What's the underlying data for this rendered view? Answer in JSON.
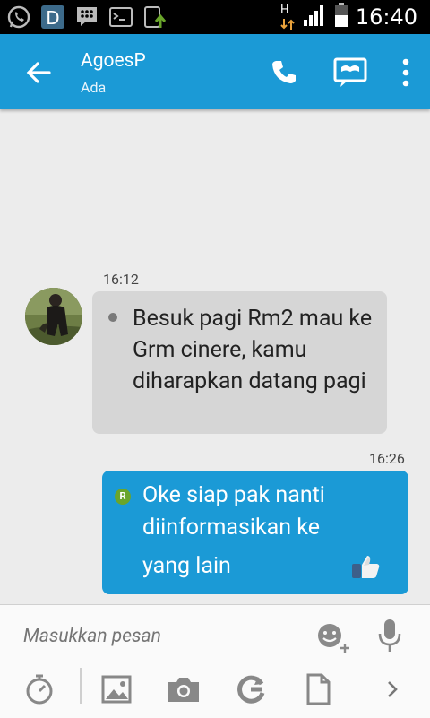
{
  "status_bar": {
    "time": "16:40",
    "network": "H"
  },
  "header": {
    "contact_name": "AgoesP",
    "status": "Ada"
  },
  "messages": [
    {
      "time": "16:12",
      "text": "Besuk pagi Rm2 mau ke Grm cinere, kamu diharapkan datang pagi"
    },
    {
      "time": "16:26",
      "text": "Oke siap pak nanti diinformasikan ke",
      "text2": "yang lain",
      "read_mark": "R"
    }
  ],
  "input": {
    "placeholder": "Masukkan pesan"
  },
  "colors": {
    "accent": "#1b9ad6",
    "incoming_bubble": "#d6d6d6",
    "read_badge": "#6aa52b"
  }
}
